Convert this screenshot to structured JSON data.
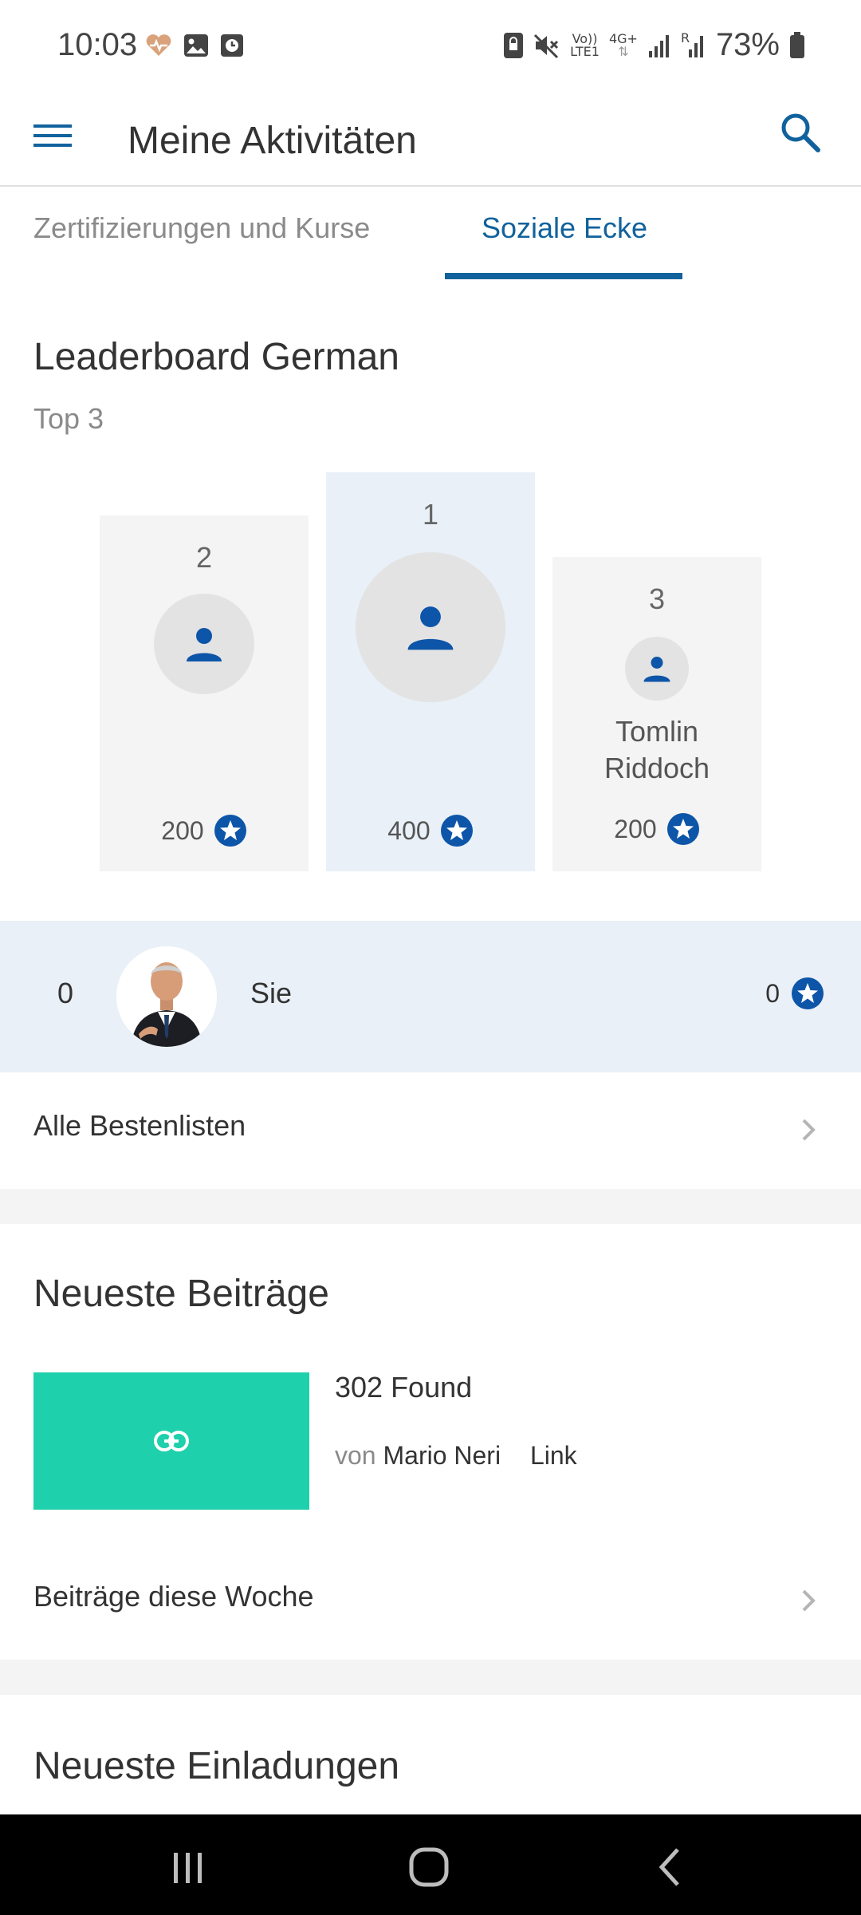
{
  "status_bar": {
    "time": "10:03",
    "battery": "73%",
    "left_icons": [
      "heart-rate-icon",
      "gallery-icon",
      "clock-app-icon"
    ],
    "right_icons": [
      "screen-lock-icon",
      "mute-icon",
      "volte-icon",
      "network-4g-icon",
      "signal-icon",
      "roaming-signal-icon",
      "battery-icon"
    ],
    "volte_top": "Vo))",
    "volte_bottom": "LTE1",
    "net_label": "4G+",
    "roaming_label": "R"
  },
  "app_bar": {
    "title": "Meine Aktivitäten"
  },
  "tabs": [
    {
      "label": "Zertifizierungen und Kurse",
      "active": false
    },
    {
      "label": "Soziale Ecke",
      "active": true
    }
  ],
  "leaderboard": {
    "title": "Leaderboard German",
    "subtitle": "Top 3",
    "podium": [
      {
        "rank": "2",
        "name": "",
        "points": "200"
      },
      {
        "rank": "1",
        "name": "",
        "points": "400"
      },
      {
        "rank": "3",
        "name": "Tomlin Riddoch",
        "points": "200"
      }
    ],
    "me": {
      "rank": "0",
      "name": "Sie",
      "points": "0"
    }
  },
  "all_leaderboards_label": "Alle Bestenlisten",
  "posts": {
    "title": "Neueste Beiträge",
    "items": [
      {
        "title": "302 Found",
        "by_prefix": "von",
        "author": "Mario Neri",
        "type": "Link"
      }
    ],
    "week_label": "Beiträge diese Woche"
  },
  "invitations": {
    "title": "Neueste Einladungen"
  },
  "colors": {
    "accent": "#11629c",
    "star": "#0d55a8",
    "podium_bg": "#f4f4f4",
    "first_bg": "#e9f0f7",
    "thumb": "#1ed0ab"
  }
}
